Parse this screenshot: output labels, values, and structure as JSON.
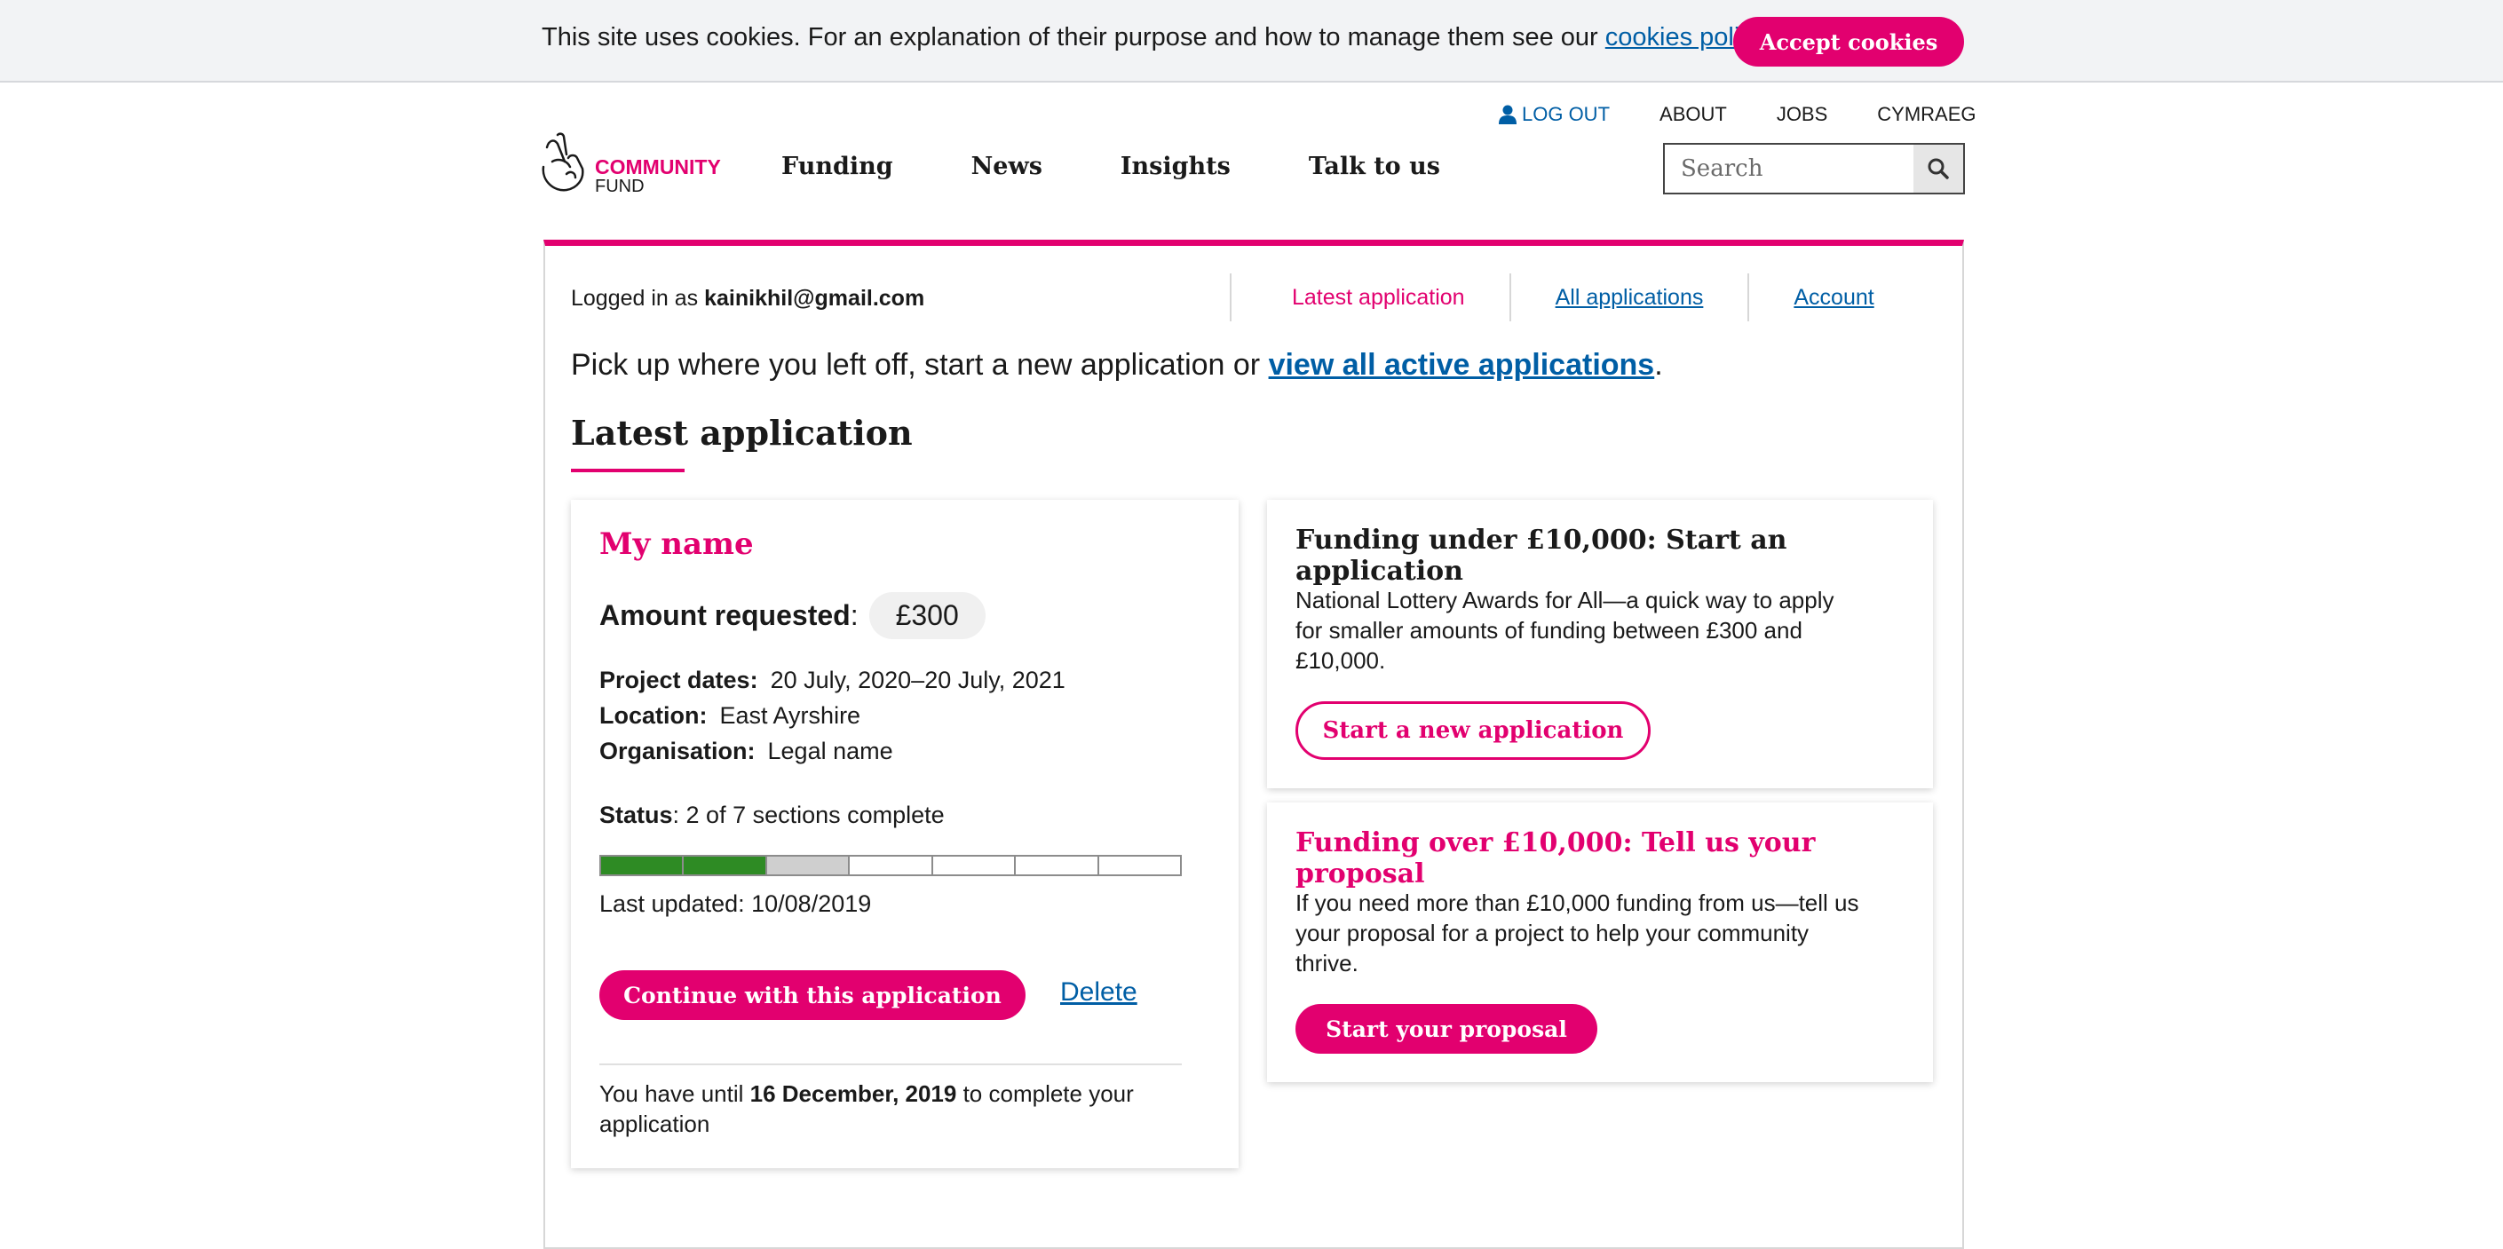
{
  "cookie_banner": {
    "text": "This site uses cookies. For an explanation of their purpose and how to manage them see our ",
    "link": "cookies policy",
    "end": ".",
    "accept": "Accept cookies"
  },
  "utility_nav": {
    "logout": "LOG OUT",
    "about": "ABOUT",
    "jobs": "JOBS",
    "cymraeg": "CYMRAEG"
  },
  "logo": {
    "line1": "COMMUNITY",
    "line2": "FUND"
  },
  "main_nav": [
    "Funding",
    "News",
    "Insights",
    "Talk to us"
  ],
  "search": {
    "placeholder": "Search"
  },
  "account": {
    "logged_in_prefix": "Logged in as ",
    "email": "kainikhil@gmail.com",
    "tabs": {
      "latest": "Latest application",
      "all": "All applications",
      "account": "Account"
    }
  },
  "intro": {
    "text": "Pick up where you left off, start a new application or ",
    "link": "view all active applications",
    "end": "."
  },
  "section_title": "Latest application",
  "application": {
    "name": "My name",
    "amount_label": "Amount requested",
    "amount_colon": ":",
    "amount": "£300",
    "project_dates_label": "Project dates:",
    "project_dates": "20 July, 2020–20 July, 2021",
    "location_label": "Location:",
    "location": "East Ayrshire",
    "organisation_label": "Organisation:",
    "organisation": "Legal name",
    "status_label": "Status",
    "status": ": 2 of 7 sections complete",
    "progress": {
      "complete": 2,
      "total": 7,
      "current": 3
    },
    "last_updated": "Last updated: 10/08/2019",
    "continue": "Continue with this application",
    "delete": "Delete",
    "deadline_prefix": "You have until ",
    "deadline_date": "16 December, 2019",
    "deadline_suffix": " to complete your application"
  },
  "funding_under": {
    "title": "Funding under £10,000: Start an application",
    "body": "National Lottery Awards for All—a quick way to apply for smaller amounts of funding between £300 and £10,000.",
    "button": "Start a new application"
  },
  "funding_over": {
    "title": "Funding over £10,000: Tell us your proposal",
    "body": "If you need more than £10,000 funding from us—tell us your proposal for a project to help your community thrive.",
    "button": "Start your proposal"
  },
  "colors": {
    "brand_pink": "#e2006f",
    "link_blue": "#005ea5",
    "progress_green": "#2e8b24"
  }
}
